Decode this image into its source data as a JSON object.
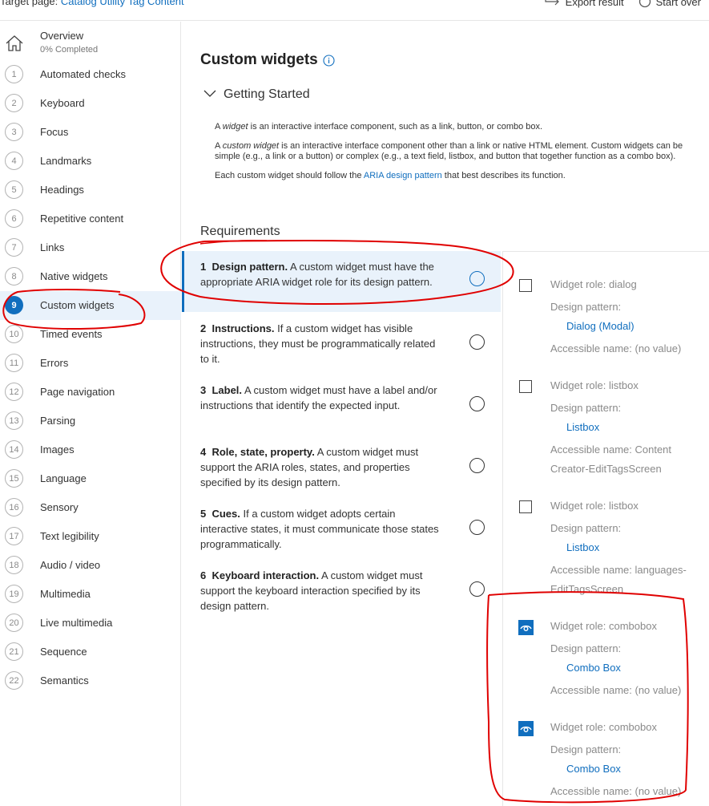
{
  "topbar": {
    "target_label": "Target page:",
    "target_name": "Catalog Utility Tag Content",
    "export_label": "Export result",
    "start_over_label": "Start over"
  },
  "sidebar": {
    "overview": {
      "title": "Overview",
      "progress": "0% Completed"
    },
    "items": [
      {
        "num": "1",
        "label": "Automated checks"
      },
      {
        "num": "2",
        "label": "Keyboard"
      },
      {
        "num": "3",
        "label": "Focus"
      },
      {
        "num": "4",
        "label": "Landmarks"
      },
      {
        "num": "5",
        "label": "Headings"
      },
      {
        "num": "6",
        "label": "Repetitive content"
      },
      {
        "num": "7",
        "label": "Links"
      },
      {
        "num": "8",
        "label": "Native widgets"
      },
      {
        "num": "9",
        "label": "Custom widgets"
      },
      {
        "num": "10",
        "label": "Timed events"
      },
      {
        "num": "11",
        "label": "Errors"
      },
      {
        "num": "12",
        "label": "Page navigation"
      },
      {
        "num": "13",
        "label": "Parsing"
      },
      {
        "num": "14",
        "label": "Images"
      },
      {
        "num": "15",
        "label": "Language"
      },
      {
        "num": "16",
        "label": "Sensory"
      },
      {
        "num": "17",
        "label": "Text legibility"
      },
      {
        "num": "18",
        "label": "Audio / video"
      },
      {
        "num": "19",
        "label": "Multimedia"
      },
      {
        "num": "20",
        "label": "Live multimedia"
      },
      {
        "num": "21",
        "label": "Sequence"
      },
      {
        "num": "22",
        "label": "Semantics"
      }
    ],
    "active_index": 8
  },
  "main": {
    "title": "Custom widgets",
    "getting_started": "Getting Started",
    "desc": {
      "p1_a": "A ",
      "p1_em": "widget",
      "p1_b": " is an interactive interface component, such as a link, button, or combo box.",
      "p2_a": "A ",
      "p2_em": "custom widget",
      "p2_b": " is an interactive interface component other than a link or native HTML element. Custom widgets can be simple (e.g., a link or a button) or complex (e.g., a text field, listbox, and button that together function as a combo box).",
      "p3_a": "Each custom widget should follow the ",
      "p3_link": "ARIA design pattern",
      "p3_b": " that best describes its function."
    },
    "requirements_heading": "Requirements",
    "requirements": [
      {
        "num": "1",
        "name": "Design pattern.",
        "text": " A custom widget must have the appropriate ARIA widget role for its design pattern."
      },
      {
        "num": "2",
        "name": "Instructions.",
        "text": " If a custom widget has visible instructions, they must be programmatically related to it."
      },
      {
        "num": "3",
        "name": "Label.",
        "text": " A custom widget must have a label and/or instructions that identify the expected input."
      },
      {
        "num": "4",
        "name": "Role, state, property.",
        "text": " A custom widget must support the ARIA roles, states, and properties specified by its design pattern."
      },
      {
        "num": "5",
        "name": "Cues.",
        "text": " If a custom widget adopts certain interactive states, it must communicate those states programmatically."
      },
      {
        "num": "6",
        "name": "Keyboard interaction.",
        "text": " A custom widget must support the keyboard interaction specified by its design pattern."
      }
    ]
  },
  "widgets": [
    {
      "role": "Widget role: dialog",
      "pattern_label": "Design pattern:",
      "pattern": "Dialog (Modal)",
      "name_1": "Accessible name: (no value)",
      "name_2": "",
      "icon": "checkbox"
    },
    {
      "role": "Widget role: listbox",
      "pattern_label": "Design pattern:",
      "pattern": "Listbox",
      "name_1": "Accessible name: Content",
      "name_2": "Creator-EditTagsScreen",
      "icon": "checkbox"
    },
    {
      "role": "Widget role: listbox",
      "pattern_label": "Design pattern:",
      "pattern": "Listbox",
      "name_1": "Accessible name: languages-",
      "name_2": "EditTagsScreen",
      "icon": "checkbox"
    },
    {
      "role": "Widget role: combobox",
      "pattern_label": "Design pattern:",
      "pattern": "Combo Box",
      "name_1": "Accessible name: (no value)",
      "name_2": "",
      "icon": "eye-icon"
    },
    {
      "role": "Widget role: combobox",
      "pattern_label": "Design pattern:",
      "pattern": "Combo Box",
      "name_1": "Accessible name: (no value)",
      "name_2": "",
      "icon": "eye-icon"
    }
  ],
  "colors": {
    "accent": "#106ebe",
    "annotation": "#e00000",
    "active_bg": "#e9f2fb"
  }
}
